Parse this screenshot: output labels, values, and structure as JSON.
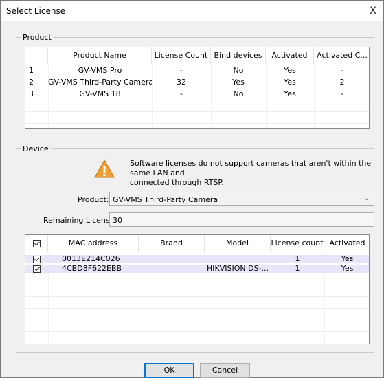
{
  "window": {
    "title": "Select License",
    "close_glyph": "X"
  },
  "product": {
    "legend": "Product",
    "columns": [
      "",
      "Product Name",
      "License Count",
      "Bind devices",
      "Activated",
      "Activated C..."
    ],
    "rows": [
      [
        "1",
        "GV-VMS Pro",
        "-",
        "No",
        "Yes",
        "-"
      ],
      [
        "2",
        "GV-VMS Third-Party Camera",
        "32",
        "Yes",
        "Yes",
        "2"
      ],
      [
        "3",
        "GV-VMS 18",
        "-",
        "No",
        "Yes",
        "-"
      ]
    ]
  },
  "device": {
    "legend": "Device",
    "warning_line1": "Software licenses do not support cameras that aren't within the same LAN and",
    "warning_line2": "connected through RTSP.",
    "warning_icon": "warning-triangle-icon",
    "product_label": "Product:",
    "product_value": "GV-VMS Third-Party Camera",
    "remaining_label": "Remaining License:",
    "remaining_value": "30",
    "columns": [
      "",
      "MAC address",
      "Brand",
      "Model",
      "License count",
      "Activated"
    ],
    "rows": [
      {
        "checked": true,
        "mac": "0013E214C026",
        "brand": "",
        "model": "",
        "count": "1",
        "activated": "Yes"
      },
      {
        "checked": true,
        "mac": "4CBD8F622EBB",
        "brand": "",
        "model": "HIKVISION DS-...",
        "count": "1",
        "activated": "Yes"
      }
    ]
  },
  "buttons": {
    "ok": "OK",
    "cancel": "Cancel"
  },
  "colors": {
    "selected_row": "#e6e6f8",
    "accent": "#0078d7",
    "warning": "#f0a030"
  }
}
